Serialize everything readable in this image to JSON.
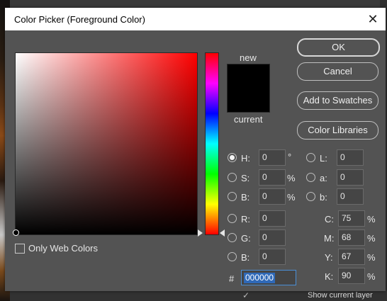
{
  "dialog": {
    "title": "Color Picker (Foreground Color)",
    "close_glyph": "✕"
  },
  "preview": {
    "new_label": "new",
    "current_label": "current",
    "color": "#000000"
  },
  "buttons": {
    "ok": "OK",
    "cancel": "Cancel",
    "add_to_swatches": "Add to Swatches",
    "color_libraries": "Color Libraries"
  },
  "only_web_colors": {
    "label": "Only Web Colors",
    "checked": false
  },
  "hsb": {
    "h": {
      "label": "H:",
      "value": "0",
      "unit": "°",
      "selected": true
    },
    "s": {
      "label": "S:",
      "value": "0",
      "unit": "%"
    },
    "b": {
      "label": "B:",
      "value": "0",
      "unit": "%"
    }
  },
  "rgb": {
    "r": {
      "label": "R:",
      "value": "0"
    },
    "g": {
      "label": "G:",
      "value": "0"
    },
    "b": {
      "label": "B:",
      "value": "0"
    }
  },
  "lab": {
    "l": {
      "label": "L:",
      "value": "0"
    },
    "a": {
      "label": "a:",
      "value": "0"
    },
    "b": {
      "label": "b:",
      "value": "0"
    }
  },
  "cmyk": {
    "c": {
      "label": "C:",
      "value": "75",
      "unit": "%"
    },
    "m": {
      "label": "M:",
      "value": "68",
      "unit": "%"
    },
    "y": {
      "label": "Y:",
      "value": "67",
      "unit": "%"
    },
    "k": {
      "label": "K:",
      "value": "90",
      "unit": "%"
    }
  },
  "hex": {
    "label": "#",
    "value": "000000"
  },
  "background_panel": {
    "show_current_layer": "Show current layer",
    "check_glyph": "✓"
  },
  "colors": {
    "dialog_bg": "#535353",
    "hue_start": "#ff0000",
    "hex_selection": "#2f69b8"
  }
}
